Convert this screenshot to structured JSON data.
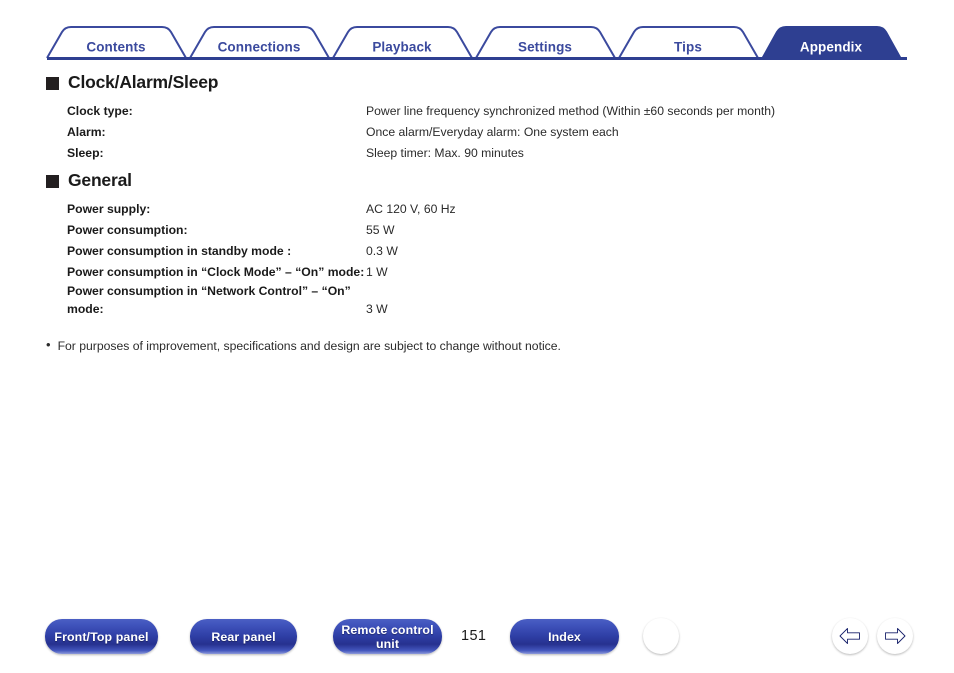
{
  "tabs": [
    {
      "label": "Contents",
      "active": false
    },
    {
      "label": "Connections",
      "active": false
    },
    {
      "label": "Playback",
      "active": false
    },
    {
      "label": "Settings",
      "active": false
    },
    {
      "label": "Tips",
      "active": false
    },
    {
      "label": "Appendix",
      "active": true
    }
  ],
  "sections": [
    {
      "title": "Clock/Alarm/Sleep",
      "rows": [
        {
          "label": "Clock type:",
          "value": "Power line frequency synchronized method (Within ±60 seconds per month)"
        },
        {
          "label": "Alarm:",
          "value": "Once alarm/Everyday alarm: One system each"
        },
        {
          "label": "Sleep:",
          "value": "Sleep timer: Max. 90 minutes"
        }
      ]
    },
    {
      "title": "General",
      "rows": [
        {
          "label": "Power supply:",
          "value": "AC 120 V, 60 Hz"
        },
        {
          "label": "Power consumption:",
          "value": "55 W"
        },
        {
          "label": "Power consumption in standby mode :",
          "value": "0.3 W"
        },
        {
          "label": "Power consumption in “Clock Mode” – “On” mode:",
          "value": "1 W"
        },
        {
          "label": "Power consumption in “Network Control” – “On” mode:",
          "value": "3 W"
        }
      ]
    }
  ],
  "note": {
    "bullet": "•",
    "text": "For purposes of improvement, specifications and design are subject to change without notice."
  },
  "footer": {
    "buttons": [
      {
        "name": "front-top-panel",
        "label": "Front/Top panel"
      },
      {
        "name": "rear-panel",
        "label": "Rear panel"
      },
      {
        "name": "remote-control-unit",
        "label": "Remote control unit"
      },
      {
        "name": "index",
        "label": "Index"
      }
    ],
    "page_number": "151",
    "home_icon": "home-icon",
    "prev_icon": "arrow-left-icon",
    "next_icon": "arrow-right-icon"
  },
  "colors": {
    "tab_blue": "#2e3f91",
    "tab_text_blue": "#3b4a9e",
    "tab_outline": "#3b4a9e",
    "text_dark": "#1a1a1a",
    "button_blue": "#2f3fa6"
  }
}
